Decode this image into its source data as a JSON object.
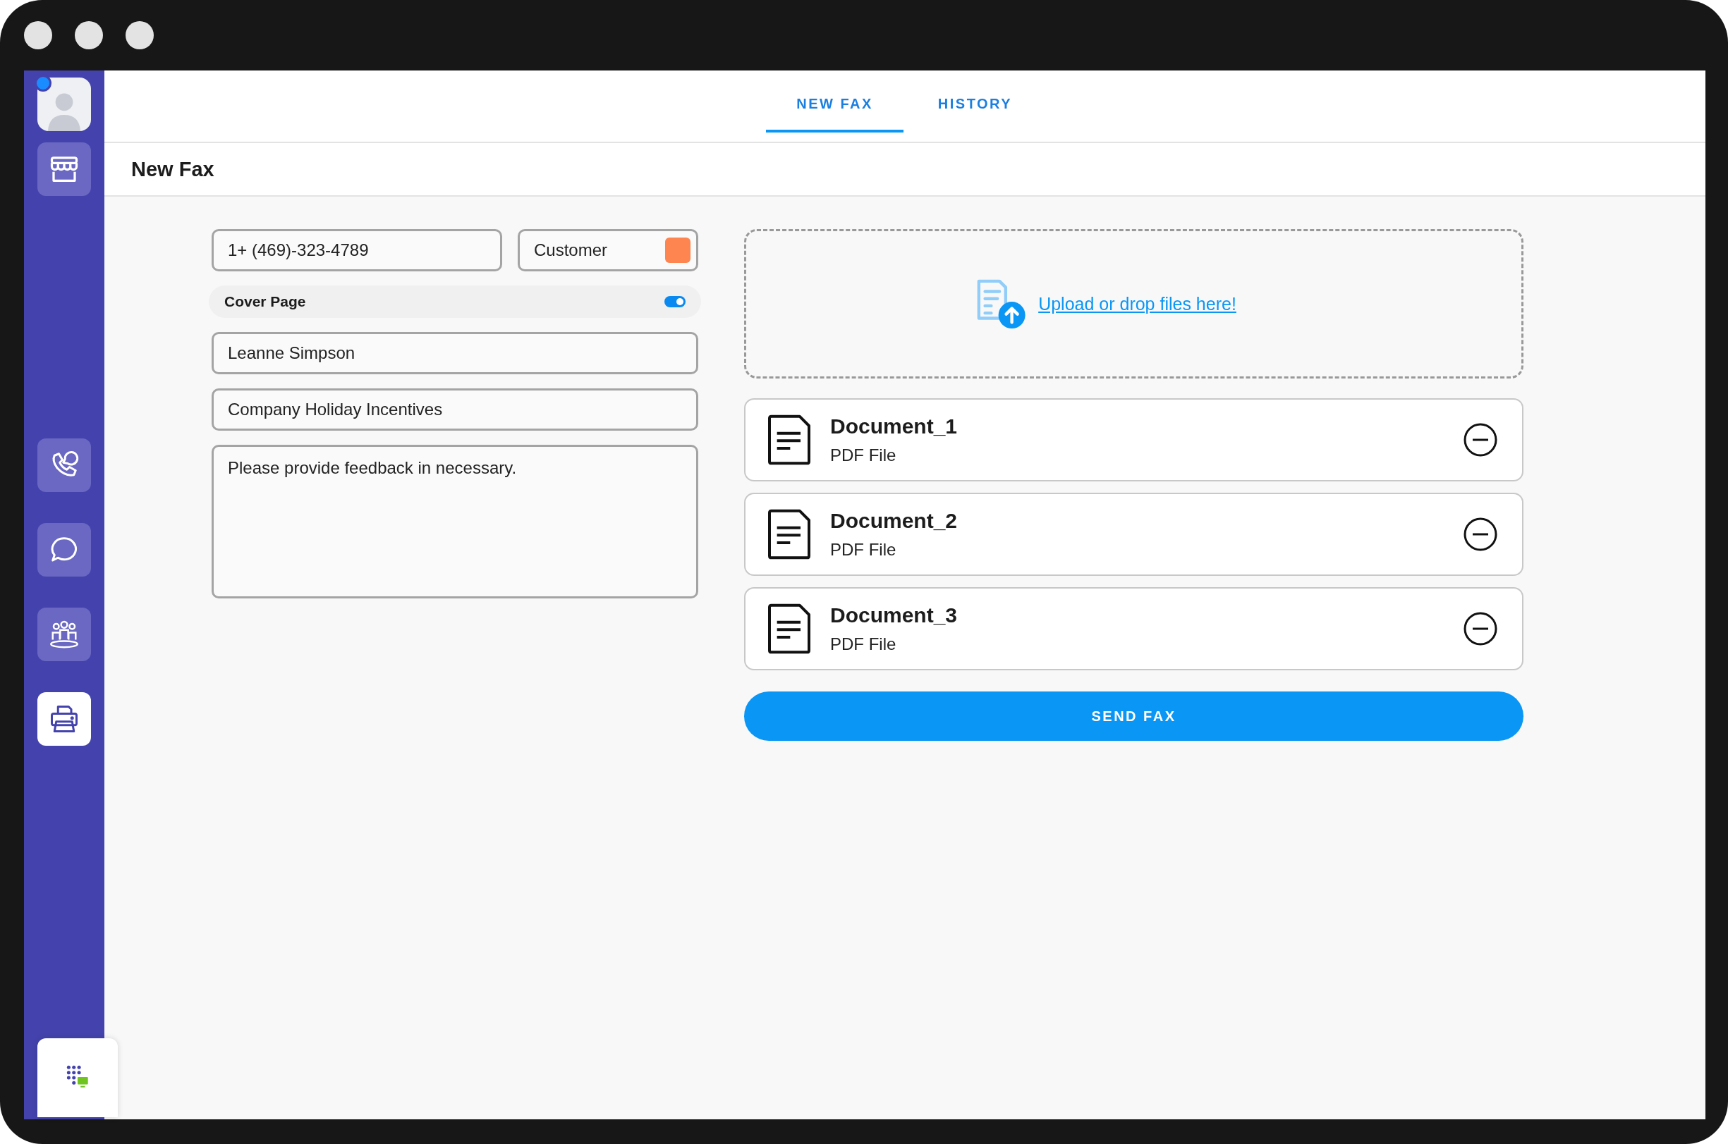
{
  "sidebar": {
    "avatar": {
      "online": true
    },
    "items": [
      {
        "kind": "store",
        "selected": false
      },
      {
        "kind": "calls",
        "selected": false
      },
      {
        "kind": "chat",
        "selected": false
      },
      {
        "kind": "contacts",
        "selected": false
      },
      {
        "kind": "fax",
        "selected": true
      }
    ]
  },
  "tabs": [
    {
      "label": "NEW FAX",
      "selected": true
    },
    {
      "label": "HISTORY",
      "selected": false
    }
  ],
  "page_title": "New Fax",
  "form": {
    "fax_number": "1+ (469)-323-4789",
    "contact_type": {
      "label": "Customer",
      "color": "#ff8550"
    },
    "cover_page": {
      "label": "Cover Page",
      "on": true
    },
    "recipient_name": "Leanne Simpson",
    "subject": "Company Holiday Incentives",
    "message": "Please provide feedback in necessary."
  },
  "upload": {
    "link": "Upload or drop files here!"
  },
  "documents": [
    {
      "name": "Document_1",
      "type": "PDF File"
    },
    {
      "name": "Document_2",
      "type": "PDF File"
    },
    {
      "name": "Document_3",
      "type": "PDF File"
    }
  ],
  "send_button": "SEND FAX"
}
